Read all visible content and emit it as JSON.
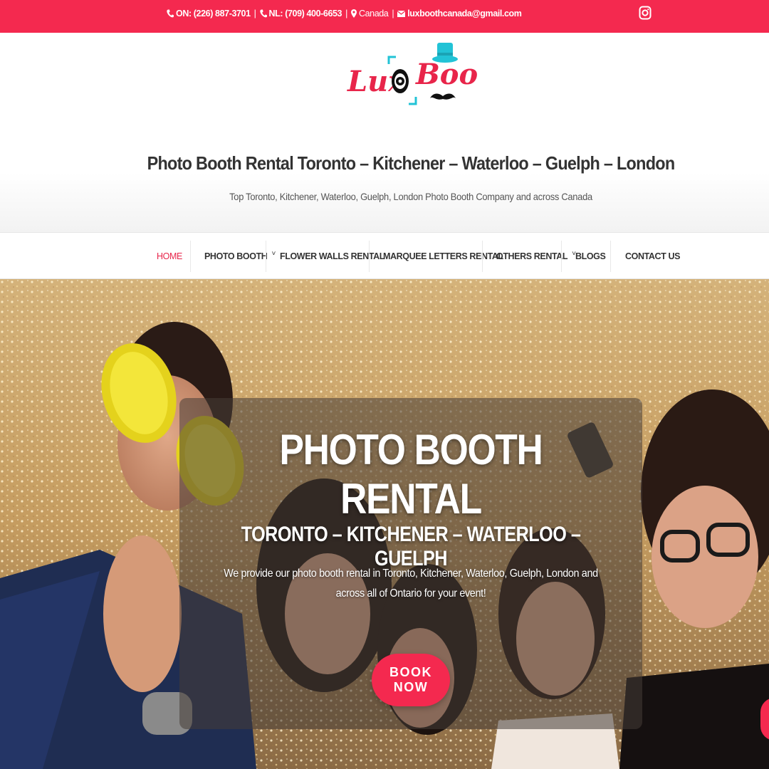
{
  "topbar": {
    "phone_on": "ON: (226) 887-3701",
    "separator": "|",
    "phone_nl": "NL: (709) 400-6653",
    "location": "Canada",
    "email": "luxboothcanada@gmail.com",
    "icons": [
      "phone-icon",
      "map-pin-icon",
      "envelope-icon",
      "instagram-icon"
    ],
    "background_color": "#f4294f"
  },
  "header": {
    "logo": {
      "text_left": "Lux",
      "text_right": "Booth",
      "colors": {
        "pink": "#e8254a",
        "cyan": "#22c3d6",
        "black": "#111111"
      }
    },
    "site_title": "Photo Booth Rental Toronto – Kitchener – Waterloo – Guelph – London",
    "tagline": "Top Toronto, Kitchener, Waterloo, Guelph, London Photo Booth Company and across Canada"
  },
  "nav": {
    "items": [
      {
        "label": "HOME",
        "active": true,
        "has_dropdown": false
      },
      {
        "label": "PHOTO BOOTH",
        "active": false,
        "has_dropdown": true
      },
      {
        "label": "FLOWER WALLS RENTAL",
        "active": false,
        "has_dropdown": false
      },
      {
        "label": "MARQUEE LETTERS RENTAL",
        "active": false,
        "has_dropdown": false
      },
      {
        "label": "OTHERS RENTAL",
        "active": false,
        "has_dropdown": true
      },
      {
        "label": "BLOGS",
        "active": false,
        "has_dropdown": false
      },
      {
        "label": "CONTACT US",
        "active": false,
        "has_dropdown": false
      }
    ],
    "caret": "˅",
    "active_color": "#e8254a"
  },
  "hero": {
    "title": "PHOTO BOOTH RENTAL",
    "subtitle": "TORONTO – KITCHENER – WATERLOO – GUELPH",
    "text": "We provide our photo booth rental in Toronto, Kitchener, Waterloo, Guelph, London and across all of Ontario for your event!",
    "button_label": "BOOK NOW",
    "button_color": "#f4294f"
  }
}
